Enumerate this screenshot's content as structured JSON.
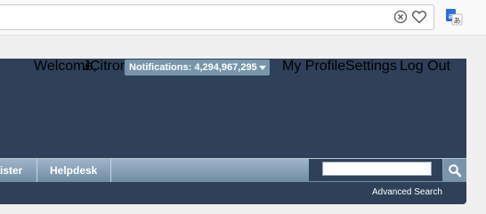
{
  "browser": {
    "icons": [
      "tracking-protection-icon",
      "heart-icon",
      "translate-extension-icon"
    ]
  },
  "header": {
    "welcome_label": "Welcome,",
    "username": "JCitron",
    "notifications_label": "Notifications: 4,294,967,295",
    "my_profile": "My Profile",
    "settings": "Settings",
    "log_out": "Log Out"
  },
  "menu": {
    "tabs": [
      {
        "label": "ister"
      },
      {
        "label": "Helpdesk"
      }
    ]
  },
  "search": {
    "value": "",
    "advanced_label": "Advanced Search"
  },
  "colors": {
    "header_bg": "#2e4158",
    "menu_bar": "#7f9bb1",
    "notification_bg": "#7895aa",
    "page_bg": "#f0f0f0"
  }
}
